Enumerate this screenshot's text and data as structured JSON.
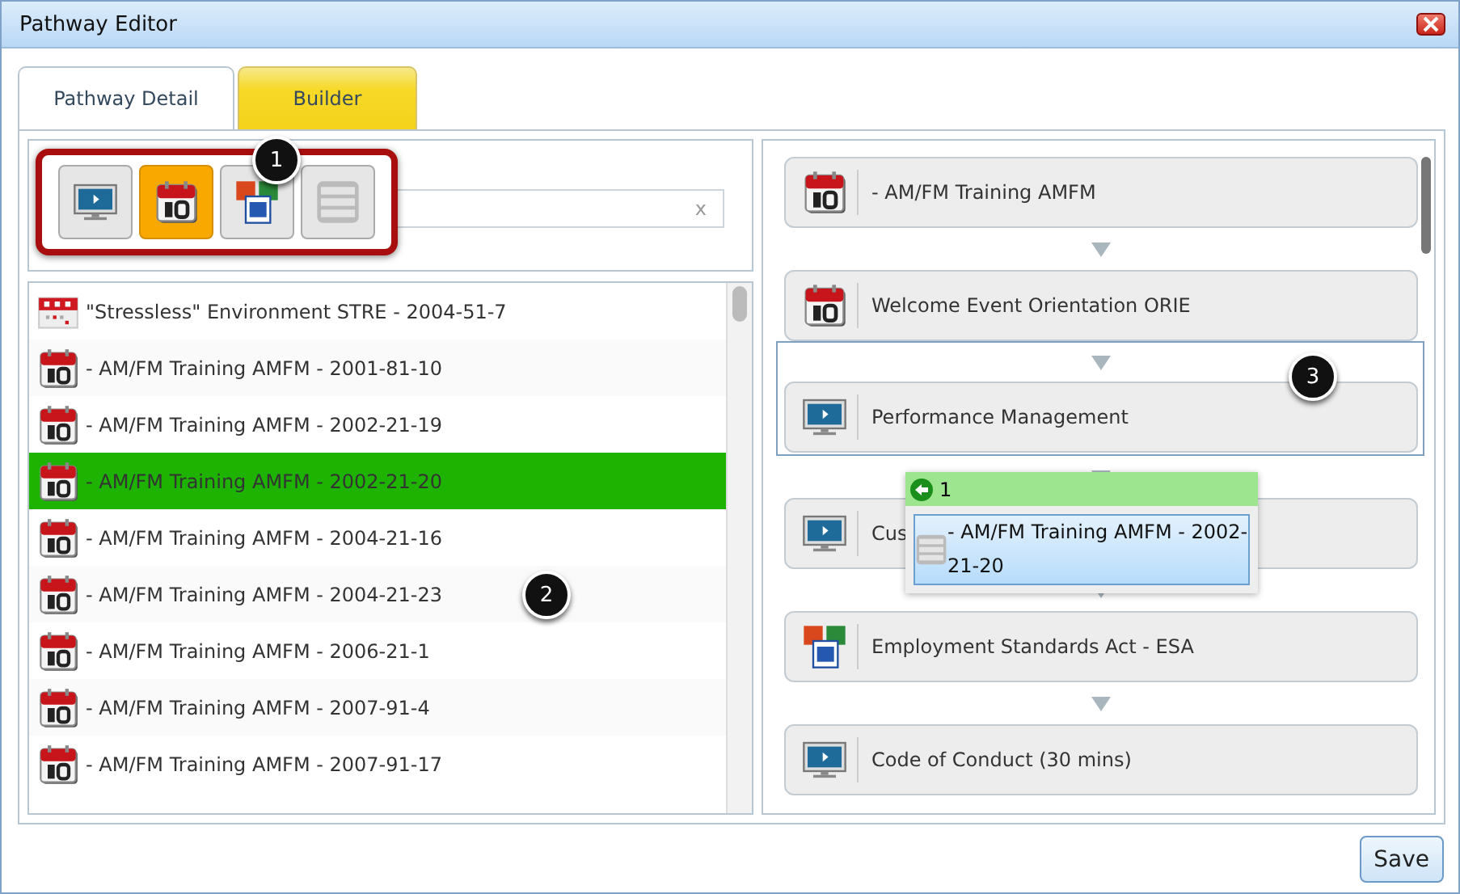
{
  "window": {
    "title": "Pathway Editor"
  },
  "tabs": [
    {
      "label": "Pathway Detail",
      "selected": false
    },
    {
      "label": "Builder",
      "selected": true
    }
  ],
  "filters": [
    {
      "kind": "elearning",
      "selected": false
    },
    {
      "kind": "event",
      "selected": true
    },
    {
      "kind": "document",
      "selected": false
    },
    {
      "kind": "curriculum",
      "selected": false
    }
  ],
  "search": {
    "clear": "x"
  },
  "catalog": [
    {
      "kind": "event-small",
      "label": "\"Stressless\" Environment STRE - 2004-51-7",
      "selected": false
    },
    {
      "kind": "event",
      "label": "- AM/FM Training AMFM - 2001-81-10",
      "selected": false
    },
    {
      "kind": "event",
      "label": "- AM/FM Training AMFM - 2002-21-19",
      "selected": false
    },
    {
      "kind": "event",
      "label": "- AM/FM Training AMFM - 2002-21-20",
      "selected": true
    },
    {
      "kind": "event",
      "label": "- AM/FM Training AMFM - 2004-21-16",
      "selected": false
    },
    {
      "kind": "event",
      "label": "- AM/FM Training AMFM - 2004-21-23",
      "selected": false
    },
    {
      "kind": "event",
      "label": "- AM/FM Training AMFM - 2006-21-1",
      "selected": false
    },
    {
      "kind": "event",
      "label": "- AM/FM Training AMFM - 2007-91-4",
      "selected": false
    },
    {
      "kind": "event",
      "label": "- AM/FM Training AMFM - 2007-91-17",
      "selected": false
    }
  ],
  "pathway": [
    {
      "kind": "event",
      "label": "- AM/FM Training AMFM",
      "drop_target": false
    },
    {
      "kind": "event",
      "label": "Welcome Event Orientation ORIE",
      "drop_target": false
    },
    {
      "kind": "elearning",
      "label": "Performance Management",
      "drop_target": true
    },
    {
      "kind": "elearning",
      "label": "Cus",
      "drop_target": false
    },
    {
      "kind": "document",
      "label": "Employment Standards Act - ESA",
      "drop_target": false
    },
    {
      "kind": "elearning",
      "label": "Code of Conduct (30 mins)",
      "drop_target": false
    }
  ],
  "drag_helper": {
    "count": "1",
    "item": {
      "kind": "curriculum",
      "label": "- AM/FM Training AMFM - 2002-21-20"
    }
  },
  "callouts": [
    "1",
    "2",
    "3"
  ],
  "buttons": [
    {
      "label": "Save"
    }
  ]
}
